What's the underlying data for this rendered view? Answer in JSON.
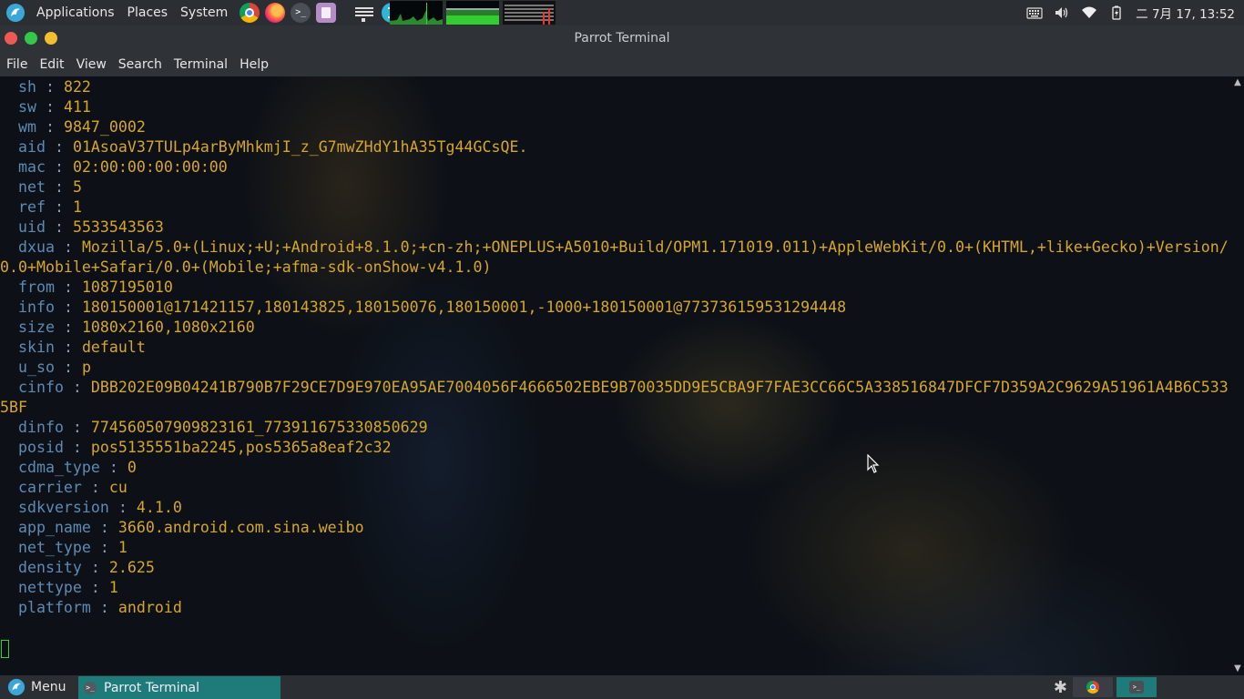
{
  "top_panel": {
    "menus": [
      "Applications",
      "Places",
      "System"
    ],
    "launchers": [
      "chrome-icon",
      "firefox-icon",
      "terminal-icon",
      "text-editor-icon",
      "network-connect-icon",
      "bluetooth-icon"
    ],
    "monitors": [
      "cpu-monitor",
      "memory-monitor",
      "network-monitor"
    ],
    "clock": "二 7月 17, 13:52"
  },
  "window": {
    "title": "Parrot Terminal"
  },
  "menubar": [
    "File",
    "Edit",
    "View",
    "Search",
    "Terminal",
    "Help"
  ],
  "terminal": {
    "lines": [
      {
        "key": "sh",
        "value": "822"
      },
      {
        "key": "sw",
        "value": "411"
      },
      {
        "key": "wm",
        "value": "9847_0002"
      },
      {
        "key": "aid",
        "value": "01AsoaV37TULp4arByMhkmjI_z_G7mwZHdY1hA35Tg44GCsQE."
      },
      {
        "key": "mac",
        "value": "02:00:00:00:00:00"
      },
      {
        "key": "net",
        "value": "5"
      },
      {
        "key": "ref",
        "value": "1"
      },
      {
        "key": "uid",
        "value": "5533543563"
      },
      {
        "key": "dxua",
        "value": "Mozilla/5.0+(Linux;+U;+Android+8.1.0;+cn-zh;+ONEPLUS+A5010+Build/OPM1.171019.011)+AppleWebKit/0.0+(KHTML,+like+Gecko)+Version/"
      },
      {
        "continuation": "0.0+Mobile+Safari/0.0+(Mobile;+afma-sdk-onShow-v4.1.0)"
      },
      {
        "key": "from",
        "value": "1087195010"
      },
      {
        "key": "info",
        "value": "180150001@171421157,180143825,180150076,180150001,-1000+180150001@773736159531294448"
      },
      {
        "key": "size",
        "value": "1080x2160,1080x2160"
      },
      {
        "key": "skin",
        "value": "default"
      },
      {
        "key": "u_so",
        "value": "p"
      },
      {
        "key": "cinfo",
        "value": "DBB202E09B04241B790B7F29CE7D9E970EA95AE7004056F4666502EBE9B70035DD9E5CBA9F7FAE3CC66C5A338516847DFCF7D359A2C9629A51961A4B6C533"
      },
      {
        "continuation": "5BF"
      },
      {
        "key": "dinfo",
        "value": "774560507909823161_773911675330850629"
      },
      {
        "key": "posid",
        "value": "pos5135551ba2245,pos5365a8eaf2c32"
      },
      {
        "key": "cdma_type",
        "value": "0"
      },
      {
        "key": "carrier",
        "value": "cu"
      },
      {
        "key": "sdkversion",
        "value": "4.1.0"
      },
      {
        "key": "app_name",
        "value": "3660.android.com.sina.weibo"
      },
      {
        "key": "net_type",
        "value": "1"
      },
      {
        "key": "density",
        "value": "2.625"
      },
      {
        "key": "nettype",
        "value": "1"
      },
      {
        "key": "platform",
        "value": "android"
      }
    ],
    "separator": " : "
  },
  "bottom_panel": {
    "menu_label": "Menu",
    "task_label": "Parrot Terminal"
  },
  "colors": {
    "key": "#5b8bb5",
    "value": "#d6a629",
    "panel": "#2b2e33",
    "titlebar": "#2f3338",
    "active_task": "#1f7a7a",
    "cursor": "#37d237"
  }
}
